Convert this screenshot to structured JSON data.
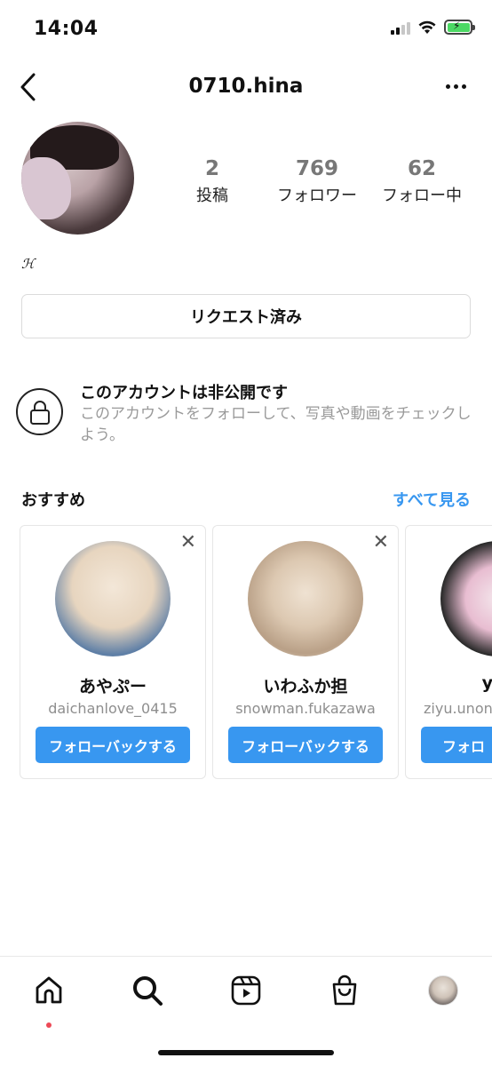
{
  "status_bar": {
    "time": "14:04",
    "icons": [
      "signal-icon",
      "wifi-icon",
      "battery-charging-icon"
    ]
  },
  "header": {
    "title": "0710.hina",
    "back_icon": "chevron-left-icon",
    "more_icon": "more-horizontal-icon"
  },
  "profile": {
    "stats": [
      {
        "value": "2",
        "label": "投稿"
      },
      {
        "value": "769",
        "label": "フォロワー"
      },
      {
        "value": "62",
        "label": "フォロー中"
      }
    ],
    "bio": "ℋ",
    "request_button": "リクエスト済み"
  },
  "private_notice": {
    "title": "このアカウントは非公開です",
    "description": "このアカウントをフォローして、写真や動画をチェックしよう。",
    "icon": "lock-icon"
  },
  "suggestions": {
    "title": "おすすめ",
    "see_all": "すべて見る",
    "cards": [
      {
        "name": "あやぷー",
        "handle": "daichanlove_0415",
        "button": "フォローバックする"
      },
      {
        "name": "いわふか担",
        "handle": "snowman.fukazawa",
        "button": "フォローバックする"
      },
      {
        "name": "y",
        "handle": "ziyu.unon",
        "button": "フォロ"
      }
    ]
  },
  "bottom_nav": {
    "items": [
      "home-icon",
      "search-icon",
      "reels-icon",
      "shop-icon",
      "profile-avatar"
    ],
    "notification_color": "#ed4956"
  },
  "colors": {
    "accent": "#3897f0",
    "secondary_text": "#8e8e8e"
  }
}
